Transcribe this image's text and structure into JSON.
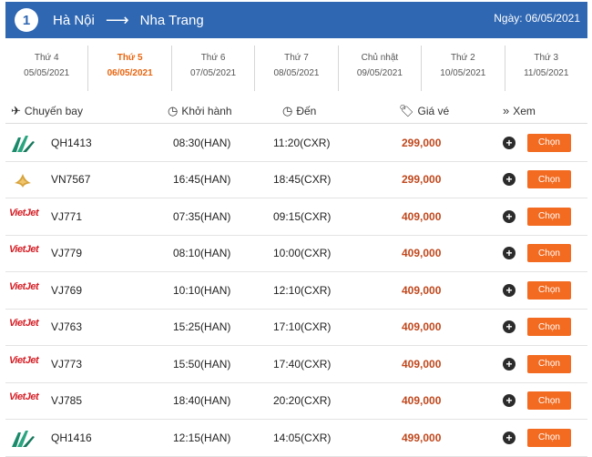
{
  "header": {
    "step": "1",
    "from": "Hà Nội",
    "to": "Nha Trang",
    "arrow": "⟶",
    "date_label": "Ngày: 06/05/2021"
  },
  "tabs": [
    {
      "dow": "Thứ 4",
      "date": "05/05/2021",
      "active": false
    },
    {
      "dow": "Thứ 5",
      "date": "06/05/2021",
      "active": true
    },
    {
      "dow": "Thứ 6",
      "date": "07/05/2021",
      "active": false
    },
    {
      "dow": "Thứ 7",
      "date": "08/05/2021",
      "active": false
    },
    {
      "dow": "Chủ nhật",
      "date": "09/05/2021",
      "active": false
    },
    {
      "dow": "Thứ 2",
      "date": "10/05/2021",
      "active": false
    },
    {
      "dow": "Thứ 3",
      "date": "11/05/2021",
      "active": false
    }
  ],
  "columns": {
    "flight": "Chuyến bay",
    "depart": "Khởi hành",
    "arrive": "Đến",
    "price": "Giá vé",
    "view": "Xem"
  },
  "flights": [
    {
      "airline": "bamboo",
      "code": "QH1413",
      "depart": "08:30(HAN)",
      "arrive": "11:20(CXR)",
      "price": "299,000",
      "select_label": "Chọn"
    },
    {
      "airline": "vna",
      "code": "VN7567",
      "depart": "16:45(HAN)",
      "arrive": "18:45(CXR)",
      "price": "299,000",
      "select_label": "Chọn"
    },
    {
      "airline": "vietjet",
      "code": "VJ771",
      "depart": "07:35(HAN)",
      "arrive": "09:15(CXR)",
      "price": "409,000",
      "select_label": "Chọn"
    },
    {
      "airline": "vietjet",
      "code": "VJ779",
      "depart": "08:10(HAN)",
      "arrive": "10:00(CXR)",
      "price": "409,000",
      "select_label": "Chọn"
    },
    {
      "airline": "vietjet",
      "code": "VJ769",
      "depart": "10:10(HAN)",
      "arrive": "12:10(CXR)",
      "price": "409,000",
      "select_label": "Chọn"
    },
    {
      "airline": "vietjet",
      "code": "VJ763",
      "depart": "15:25(HAN)",
      "arrive": "17:10(CXR)",
      "price": "409,000",
      "select_label": "Chọn"
    },
    {
      "airline": "vietjet",
      "code": "VJ773",
      "depart": "15:50(HAN)",
      "arrive": "17:40(CXR)",
      "price": "409,000",
      "select_label": "Chọn"
    },
    {
      "airline": "vietjet",
      "code": "VJ785",
      "depart": "18:40(HAN)",
      "arrive": "20:20(CXR)",
      "price": "409,000",
      "select_label": "Chọn"
    },
    {
      "airline": "bamboo",
      "code": "QH1416",
      "depart": "12:15(HAN)",
      "arrive": "14:05(CXR)",
      "price": "499,000",
      "select_label": "Chọn"
    }
  ],
  "logo_text": {
    "vietjet": "VietJet"
  },
  "icons": {
    "flight": "airplane-icon",
    "depart": "clock-icon",
    "arrive": "clock-icon",
    "price": "tag-icon",
    "view": "chevrons-down-icon",
    "expand": "plus-circle-icon"
  },
  "colors": {
    "header_bg": "#2f67b2",
    "accent": "#e8650f",
    "button": "#f26b21",
    "price": "#c0471c",
    "vietjet": "#d51f26"
  }
}
